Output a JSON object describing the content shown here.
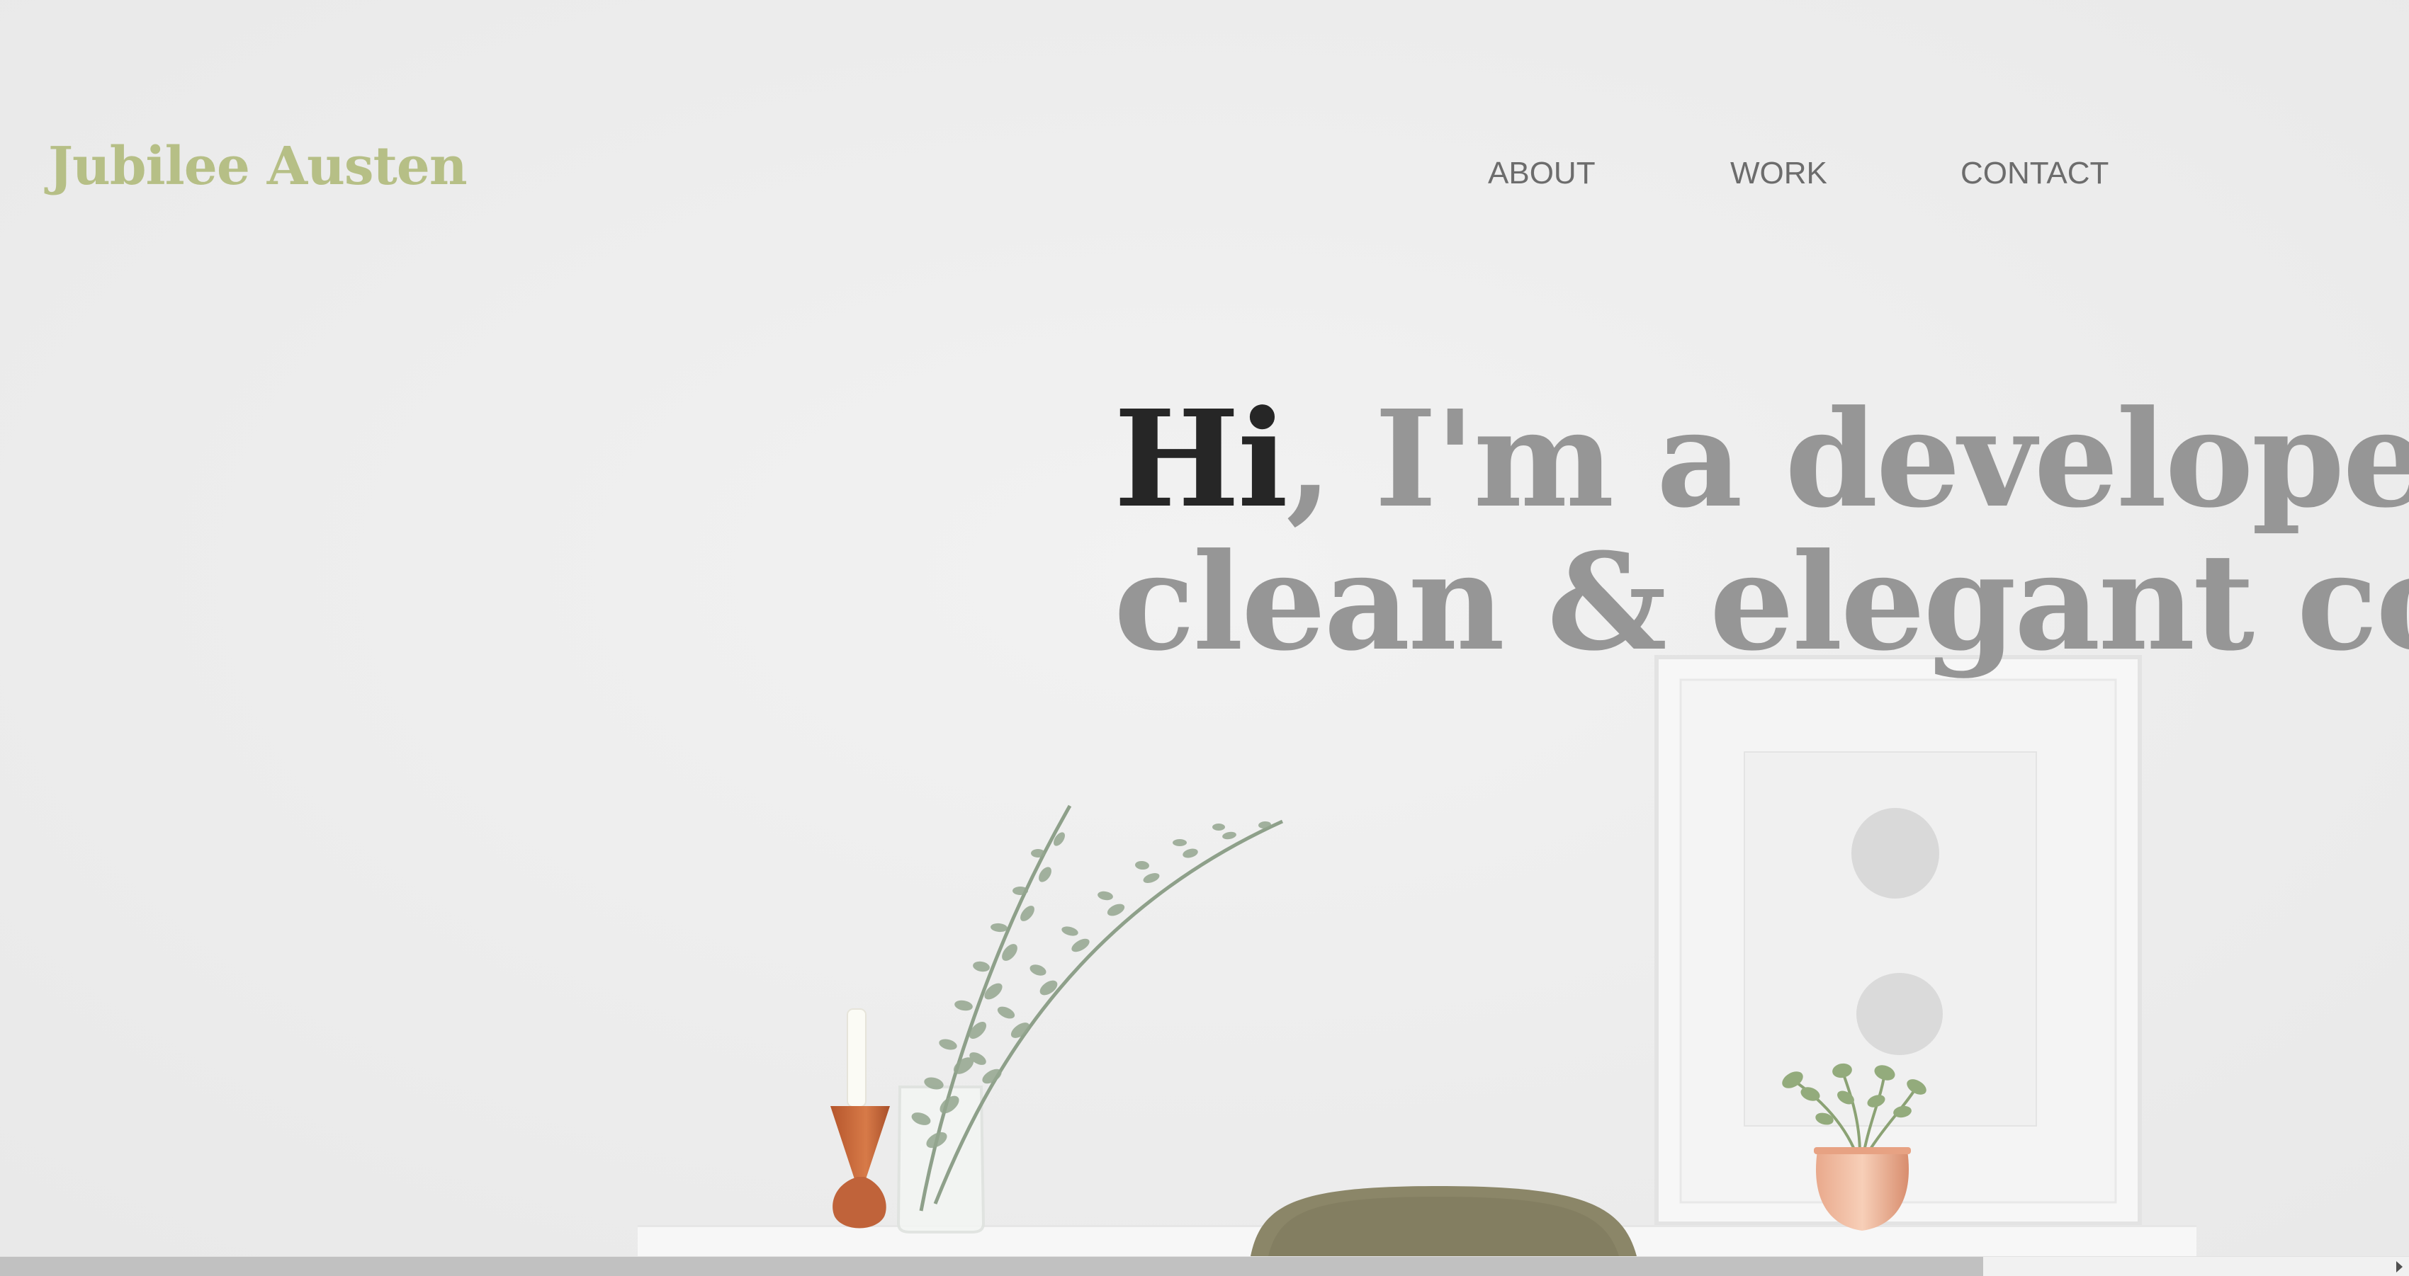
{
  "header": {
    "brand": "Jubilee Austen",
    "nav": {
      "about": "ABOUT",
      "work": "WORK",
      "contact": "CONTACT"
    }
  },
  "hero": {
    "headline_hi": "Hi",
    "headline_rest": ", I'm a developer th",
    "headline_line2": "clean & elegant code."
  },
  "scrollbar": {
    "horizontal_position_fraction": 0.83
  },
  "colors": {
    "brand": "#b6bf86",
    "headline_emphasis": "#262626",
    "headline_text": "#969696",
    "nav_text": "#6c6c6c",
    "background": "#eeeeee"
  },
  "icons": {
    "scroll_right": "scroll-right-arrow-icon"
  }
}
